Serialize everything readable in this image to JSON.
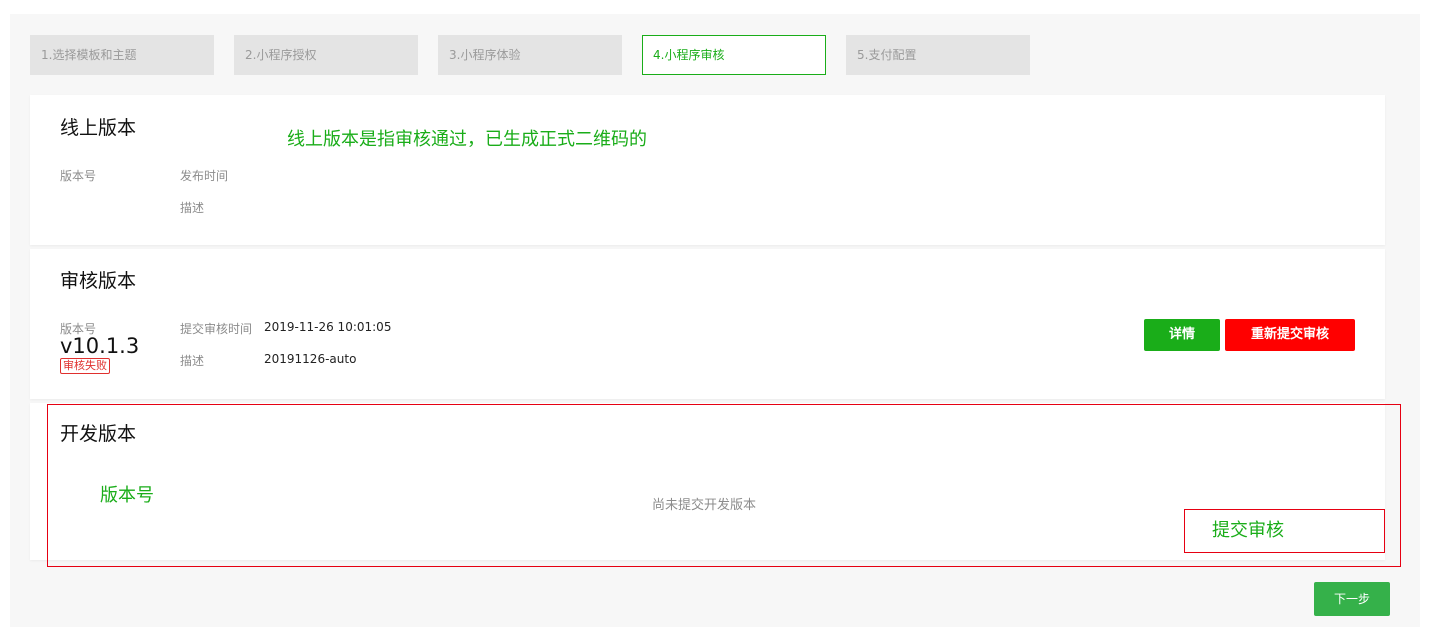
{
  "steps": [
    {
      "label": "1.选择模板和主题"
    },
    {
      "label": "2.小程序授权"
    },
    {
      "label": "3.小程序体验"
    },
    {
      "label": "4.小程序审核"
    },
    {
      "label": "5.支付配置"
    }
  ],
  "online": {
    "title": "线上版本",
    "annotation": "线上版本是指审核通过，已生成正式二维码的",
    "version_label": "版本号",
    "publish_time_label": "发布时间",
    "desc_label": "描述"
  },
  "review": {
    "title": "审核版本",
    "version_label": "版本号",
    "version_value": "v10.1.3",
    "status": "审核失败",
    "submit_time_label": "提交审核时间",
    "submit_time_value": "2019-11-26 10:01:05",
    "desc_label": "描述",
    "desc_value": "20191126-auto",
    "detail_button": "详情",
    "resubmit_button": "重新提交审核"
  },
  "dev": {
    "title": "开发版本",
    "version_annotation": "版本号",
    "empty_text": "尚未提交开发版本",
    "submit_annotation": "提交审核"
  },
  "next_button": "下一步",
  "colors": {
    "accent": "#1aad19",
    "danger": "#ff0000",
    "highlight_border": "#e60012"
  }
}
